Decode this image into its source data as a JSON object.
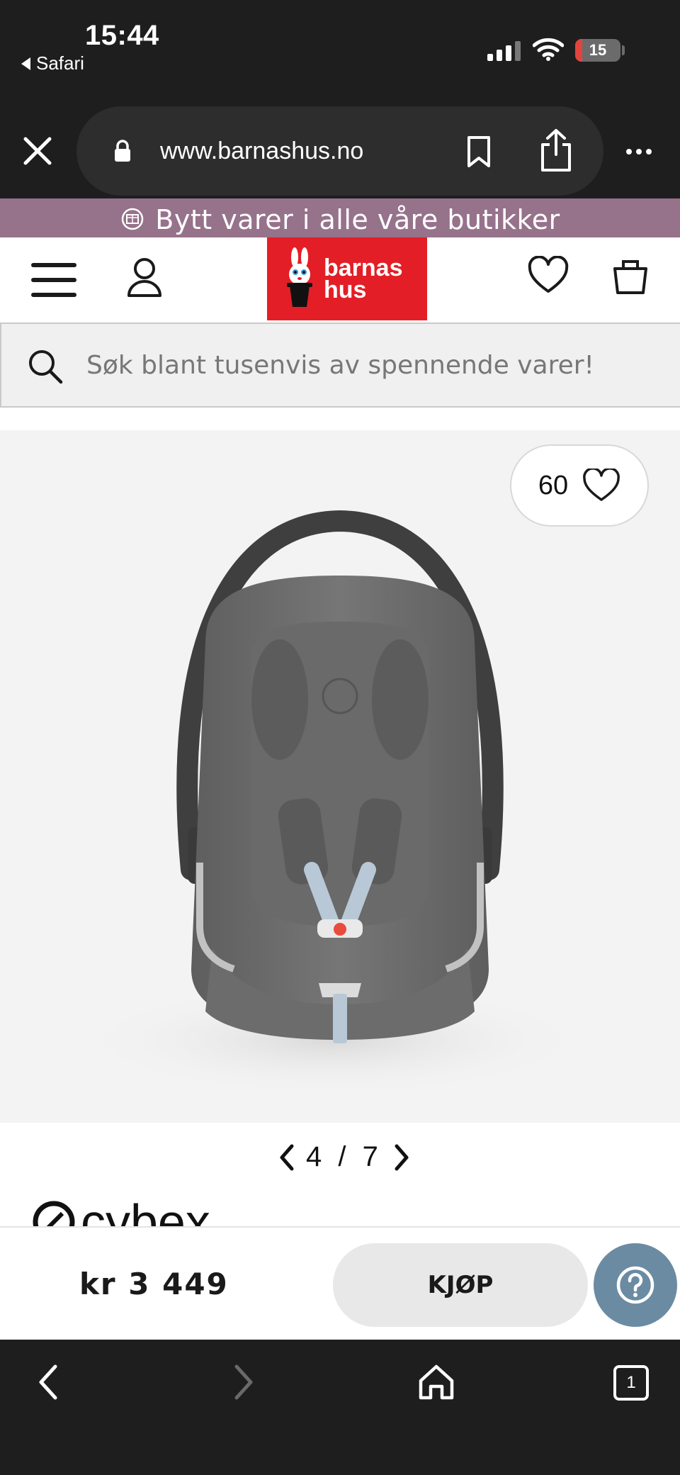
{
  "status_bar": {
    "time": "15:44",
    "back_app": "Safari",
    "battery": "15",
    "battery_level": 0.15,
    "battery_color": "#e0453d"
  },
  "browser": {
    "url": "www.barnashus.no",
    "icons": [
      "close-icon",
      "lock-icon",
      "bookmark-icon",
      "share-icon",
      "more-icon"
    ]
  },
  "promo": {
    "text": "Bytt varer i alle våre butikker",
    "background": "#96728b"
  },
  "header": {
    "logo_line1": "barnas",
    "logo_line2": "hus",
    "logo_color": "#e41e26"
  },
  "search": {
    "placeholder": "Søk blant tusenvis av spennende varer!"
  },
  "product": {
    "favorites_count": "60",
    "gallery_current": "4",
    "gallery_total": "7",
    "brand": "cybex",
    "price": "kr 3 449",
    "buy_label": "KJØP"
  },
  "toolbar": {
    "icons": [
      "back-icon",
      "forward-icon",
      "home-icon",
      "tabs-icon"
    ],
    "tab_count": "1"
  }
}
